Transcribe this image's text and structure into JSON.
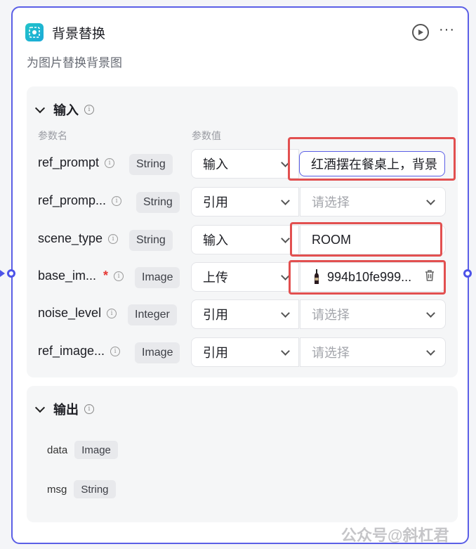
{
  "node": {
    "title": "背景替换",
    "description": "为图片替换背景图"
  },
  "input_section": {
    "title": "输入",
    "col_name": "参数名",
    "col_value": "参数值",
    "params": [
      {
        "name": "ref_prompt",
        "type": "String",
        "mode": "输入",
        "value": "红酒摆在餐桌上，背景",
        "required": false
      },
      {
        "name": "ref_promp...",
        "type": "String",
        "mode": "引用",
        "placeholder": "请选择",
        "required": false
      },
      {
        "name": "scene_type",
        "type": "String",
        "mode": "输入",
        "value": "ROOM",
        "required": false
      },
      {
        "name": "base_im...",
        "type": "Image",
        "mode": "上传",
        "value": "994b10fe999...",
        "required": true,
        "required_mark": "*"
      },
      {
        "name": "noise_level",
        "type": "Integer",
        "mode": "引用",
        "placeholder": "请选择",
        "required": false
      },
      {
        "name": "ref_image...",
        "type": "Image",
        "mode": "引用",
        "placeholder": "请选择",
        "required": false
      }
    ]
  },
  "output_section": {
    "title": "输出",
    "outputs": [
      {
        "name": "data",
        "type": "Image"
      },
      {
        "name": "msg",
        "type": "String"
      }
    ]
  },
  "watermark": "公众号@斜杠君",
  "icons": {
    "app": "image-replace-icon",
    "run": "play-icon",
    "more": "more-icon",
    "info": "info-icon",
    "trash": "trash-icon"
  },
  "colors": {
    "accent": "#5b5fe6",
    "highlight": "#e25050",
    "app_icon": "#22c4c9"
  }
}
